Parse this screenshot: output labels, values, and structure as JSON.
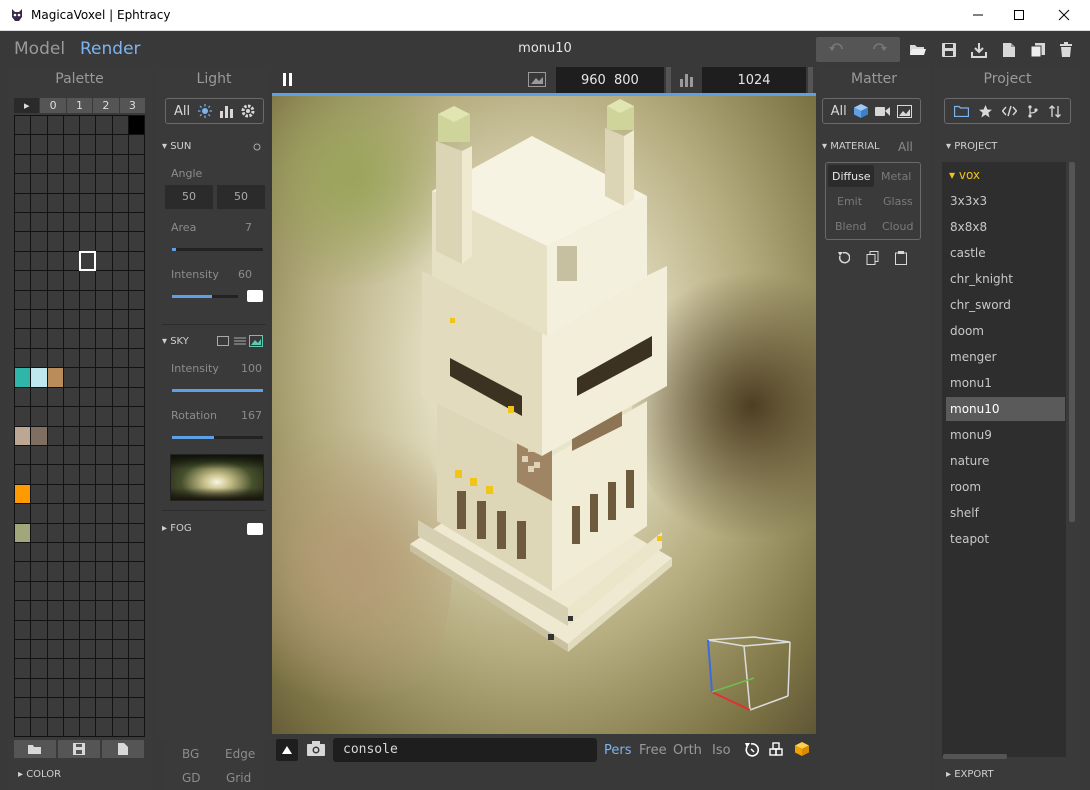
{
  "window": {
    "title": "MagicaVoxel | Ephtracy"
  },
  "modes": {
    "model": "Model",
    "render": "Render"
  },
  "project_name": "monu10",
  "palette": {
    "title": "Palette",
    "tabs": [
      "▸",
      "0",
      "1",
      "2",
      "3"
    ],
    "color_section": "COLOR",
    "colored_cells": [
      {
        "index": 7,
        "color": "#000000"
      },
      {
        "index": 104,
        "color": "#2fb6a8"
      },
      {
        "index": 105,
        "color": "#bfe7ee"
      },
      {
        "index": 106,
        "color": "#b98c5a"
      },
      {
        "index": 128,
        "color": "#bca792"
      },
      {
        "index": 129,
        "color": "#7f6f62"
      },
      {
        "index": 152,
        "color": "#ff9a00"
      },
      {
        "index": 168,
        "color": "#a2a77b"
      }
    ],
    "selected_index": 60
  },
  "light": {
    "title": "Light",
    "tabs": {
      "all": "All"
    },
    "sun": {
      "label": "SUN",
      "angle_label": "Angle",
      "angle1": "50",
      "angle2": "50",
      "area_label": "Area",
      "area": "7",
      "area_level": 0.04,
      "intensity_label": "Intensity",
      "intensity": "60",
      "intensity_level": 0.6
    },
    "sky": {
      "label": "SKY",
      "intensity_label": "Intensity",
      "intensity": "100",
      "intensity_level": 1.0,
      "rotation_label": "Rotation",
      "rotation": "167",
      "rotation_level": 0.46
    },
    "fog": {
      "label": "FOG"
    },
    "bottom": {
      "bg": "BG",
      "edge": "Edge",
      "gd": "GD",
      "grid": "Grid"
    }
  },
  "viewport": {
    "width": "960",
    "height": "800",
    "samples": "1024",
    "console_placeholder": "console",
    "view_modes": {
      "pers": "Pers",
      "free": "Free",
      "orth": "Orth",
      "iso": "Iso"
    },
    "active_view_mode": "Pers"
  },
  "matter": {
    "title": "Matter",
    "tabs": {
      "all": "All"
    },
    "material_label": "MATERIAL",
    "material_all": "All",
    "types": {
      "diffuse": "Diffuse",
      "metal": "Metal",
      "emit": "Emit",
      "glass": "Glass",
      "blend": "Blend",
      "cloud": "Cloud"
    },
    "active_type": "Diffuse"
  },
  "project": {
    "title": "Project",
    "section": "PROJECT",
    "folder": "vox",
    "items": [
      "3x3x3",
      "8x8x8",
      "castle",
      "chr_knight",
      "chr_sword",
      "doom",
      "menger",
      "monu1",
      "monu10",
      "monu9",
      "nature",
      "room",
      "shelf",
      "teapot"
    ],
    "selected": "monu10",
    "export": "EXPORT"
  },
  "colors": {
    "accent": "#7db4f0",
    "folder": "#f0c419",
    "background": "#393939"
  }
}
